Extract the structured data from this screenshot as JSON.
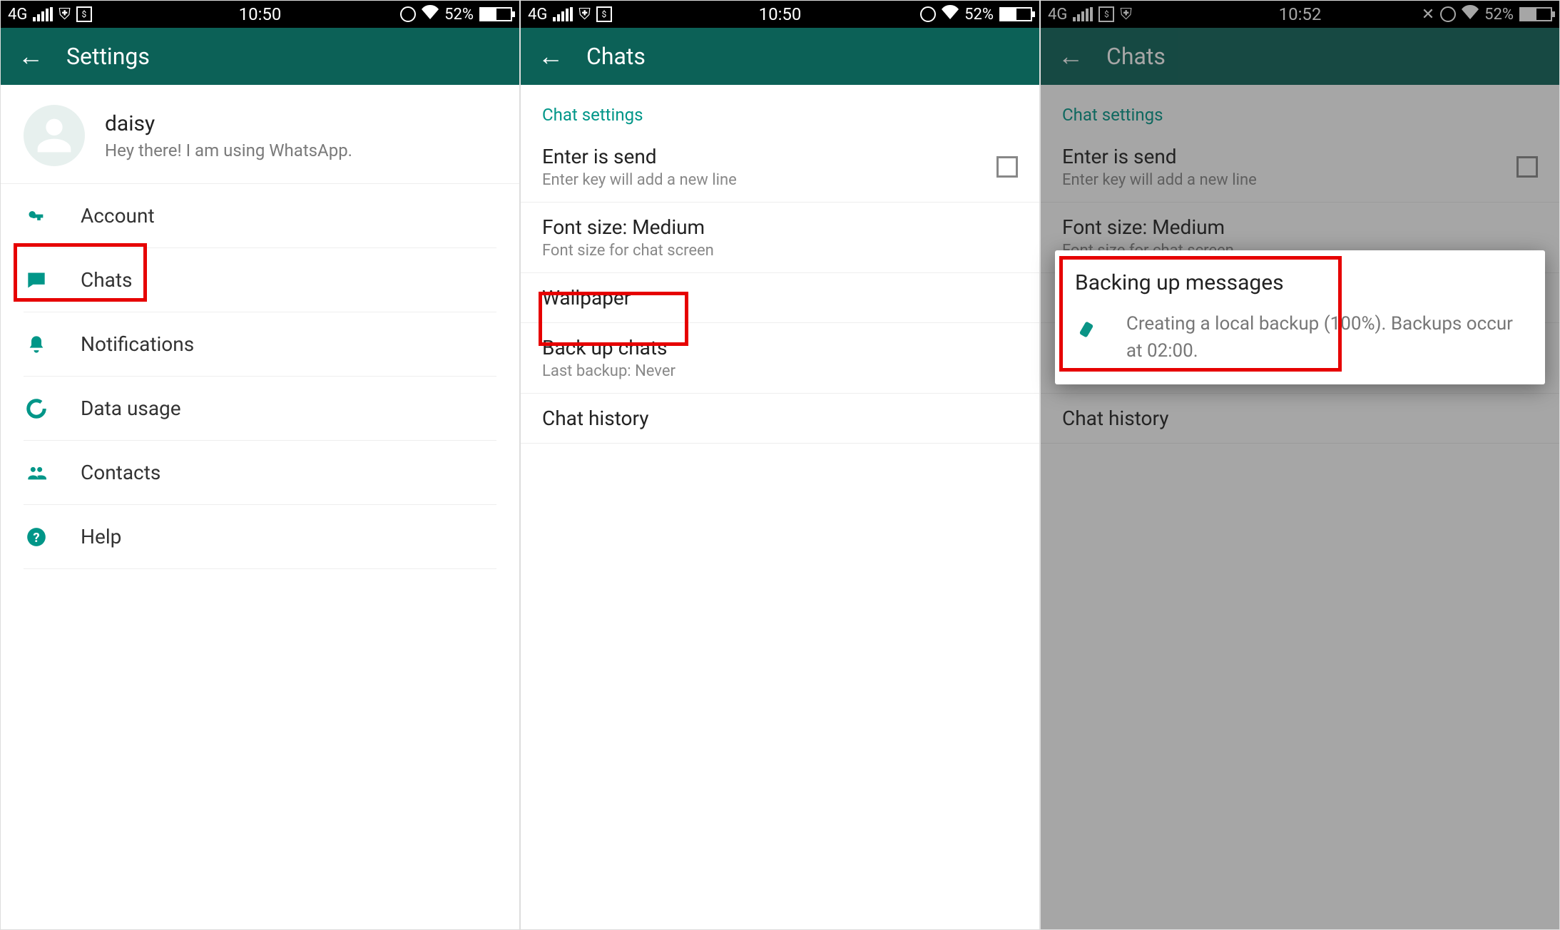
{
  "status": {
    "net": "4G",
    "time1": "10:50",
    "time2": "10:50",
    "time3": "10:52",
    "battery_pct": "52%",
    "dollar": "$"
  },
  "colors": {
    "brand": "#0c6157",
    "accent": "#009688",
    "highlight": "#e60000"
  },
  "screen1": {
    "title": "Settings",
    "profile": {
      "name": "daisy",
      "status_text": "Hey there! I am using WhatsApp."
    },
    "items": [
      {
        "label": "Account"
      },
      {
        "label": "Chats"
      },
      {
        "label": "Notifications"
      },
      {
        "label": "Data usage"
      },
      {
        "label": "Contacts"
      },
      {
        "label": "Help"
      }
    ]
  },
  "screen2": {
    "title": "Chats",
    "section": "Chat settings",
    "rows": [
      {
        "title": "Enter is send",
        "desc": "Enter key will add a new line",
        "checkbox": true
      },
      {
        "title": "Font size: Medium",
        "desc": "Font size for chat screen"
      },
      {
        "title": "Wallpaper"
      },
      {
        "title": "Back up chats",
        "desc": "Last backup: Never"
      },
      {
        "title": "Chat history"
      }
    ]
  },
  "screen3": {
    "modal": {
      "title": "Backing up messages",
      "body": "Creating a local backup (100%). Backups occur at 02:00."
    }
  }
}
